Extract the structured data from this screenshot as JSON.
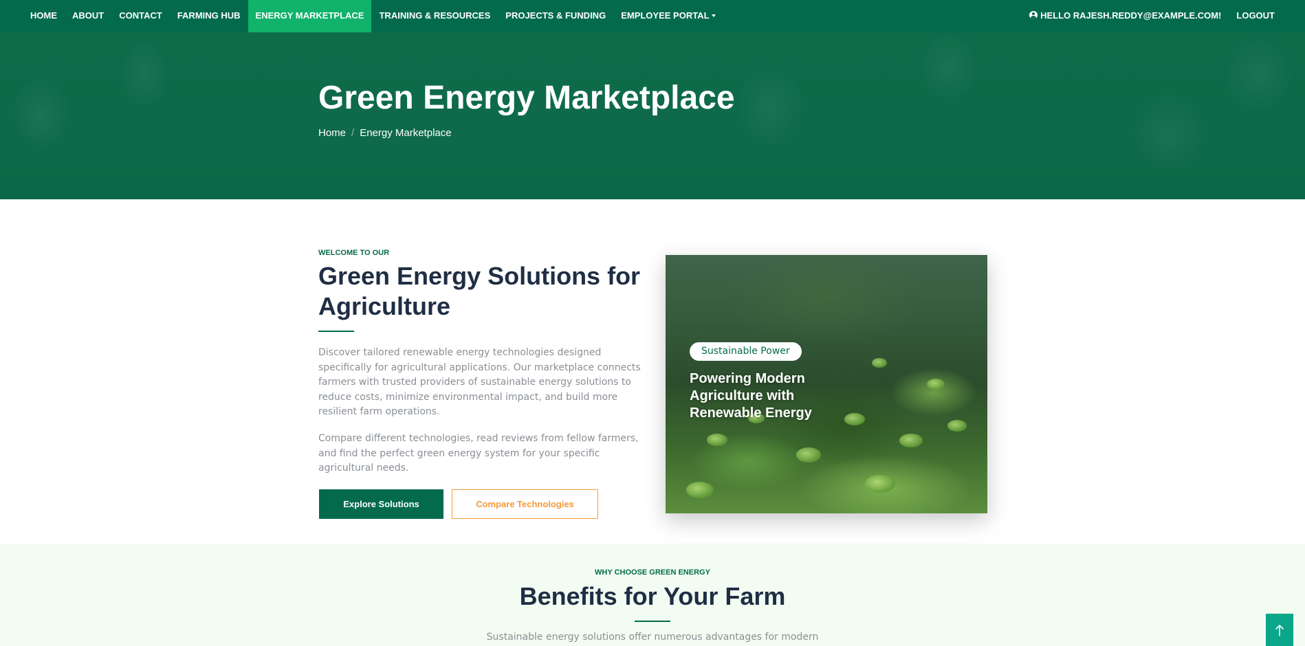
{
  "nav": {
    "items": [
      {
        "label": "HOME"
      },
      {
        "label": "ABOUT"
      },
      {
        "label": "CONTACT"
      },
      {
        "label": "FARMING HUB"
      },
      {
        "label": "ENERGY MARKETPLACE"
      },
      {
        "label": "TRAINING & RESOURCES"
      },
      {
        "label": "PROJECTS & FUNDING"
      },
      {
        "label": "EMPLOYEE PORTAL"
      }
    ],
    "active": "ENERGY MARKETPLACE",
    "greeting": "HELLO RAJESH.REDDY@EXAMPLE.COM!",
    "logout": "LOGOUT"
  },
  "hero": {
    "title": "Green Energy Marketplace",
    "breadcrumb": [
      "Home",
      "Energy Marketplace"
    ],
    "breadcrumb_separator": "/"
  },
  "about": {
    "kicker": "WELCOME TO OUR",
    "title": "Green Energy Solutions for Agriculture",
    "paragraph1": "Discover tailored renewable energy technologies designed specifically for agricultural applications. Our marketplace connects farmers with trusted providers of sustainable energy solutions to reduce costs, minimize environmental impact, and build more resilient farm operations.",
    "paragraph2": "Compare different technologies, read reviews from fellow farmers, and find the perfect green energy system for your specific agricultural needs.",
    "primary_button": "Explore Solutions",
    "secondary_button": "Compare Technologies"
  },
  "card": {
    "tag": "Sustainable Power",
    "title": "Powering Modern Agriculture with Renewable Energy"
  },
  "benefits": {
    "kicker": "WHY CHOOSE GREEN ENERGY",
    "title": "Benefits for Your Farm",
    "text": "Sustainable energy solutions offer numerous advantages for modern"
  },
  "colors": {
    "nav_bg": "#036b4b",
    "nav_active": "#10b26c",
    "heading": "#1f2e44",
    "accent_orange": "#f39a3b",
    "benefits_bg": "#f2fcf2",
    "back_to_top": "#0aa68a"
  },
  "icons": {
    "user": "user-circle-icon",
    "dropdown": "caret-down-icon",
    "back_to_top": "arrow-up-icon"
  }
}
